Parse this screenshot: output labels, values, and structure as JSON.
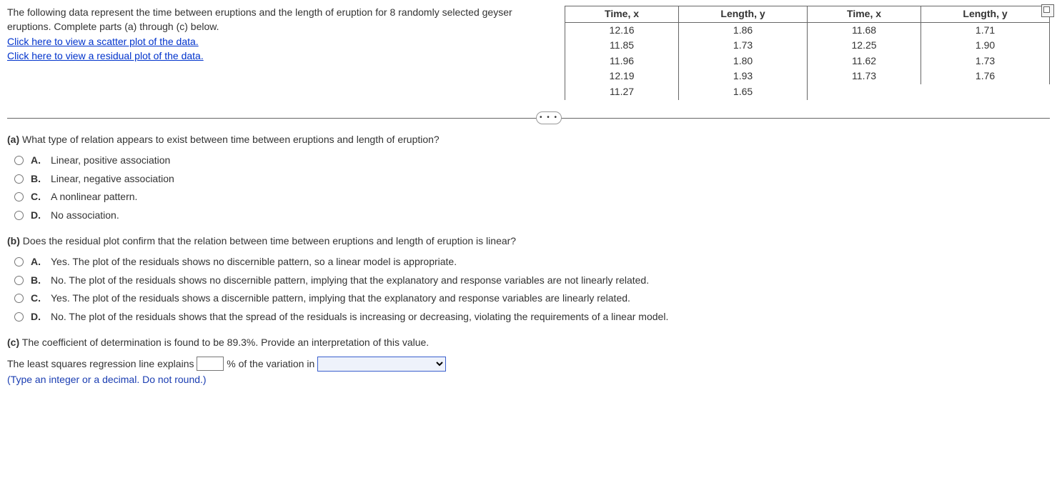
{
  "intro": {
    "text": "The following data represent the time between eruptions and the length of eruption for 8 randomly selected geyser eruptions.  Complete parts (a) through (c) below.",
    "link_scatter": "Click here to view a scatter plot of the data.",
    "link_residual": "Click here to view a residual plot of the data."
  },
  "table": {
    "h1": "Time, x",
    "h2": "Length, y",
    "h3": "Time, x",
    "h4": "Length, y",
    "rows": [
      [
        "12.16",
        "1.86",
        "11.68",
        "1.71"
      ],
      [
        "11.85",
        "1.73",
        "12.25",
        "1.90"
      ],
      [
        "11.96",
        "1.80",
        "11.62",
        "1.73"
      ],
      [
        "12.19",
        "1.93",
        "11.73",
        "1.76"
      ],
      [
        "11.27",
        "1.65",
        "",
        ""
      ]
    ]
  },
  "ellipsis": "• • •",
  "qa": {
    "label": "(a)",
    "text": "What type of relation appears to exist between time between eruptions and length of eruption?",
    "opts": {
      "A": "Linear, positive association",
      "B": "Linear, negative association",
      "C": "A nonlinear pattern.",
      "D": "No association."
    }
  },
  "qb": {
    "label": "(b)",
    "text": "Does the residual plot confirm that the relation between time between eruptions and length of eruption is linear?",
    "opts": {
      "A": "Yes. The plot of the residuals shows no discernible pattern, so a linear model is appropriate.",
      "B": "No. The plot of the residuals shows no discernible pattern, implying that the explanatory and response variables are not linearly related.",
      "C": "Yes. The plot of the residuals shows a discernible pattern, implying that the explanatory and response variables are linearly related.",
      "D": "No. The plot of the residuals shows that the spread of the residuals is increasing or decreasing, violating the requirements of a linear model."
    }
  },
  "qc": {
    "label": "(c)",
    "text": "The coefficient of determination is found to be 89.3%. Provide an interpretation of this value.",
    "fill_before": "The least squares regression line explains",
    "fill_mid": "% of the variation in",
    "hint": "(Type an integer or a decimal. Do not round.)",
    "select_placeholder": ""
  }
}
